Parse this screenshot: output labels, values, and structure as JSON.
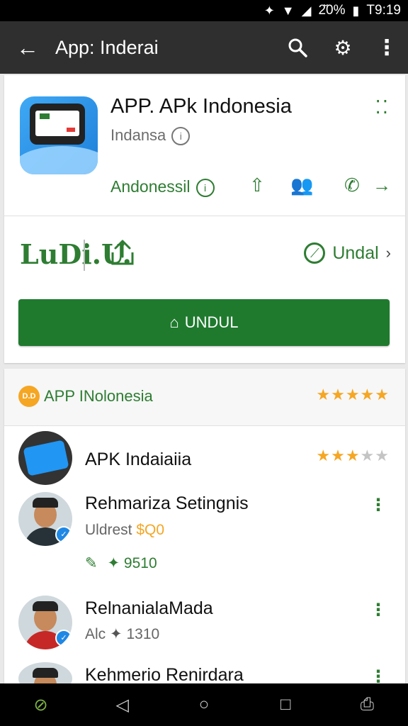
{
  "status_bar": {
    "battery_text": "2̆0%",
    "time": "T9:19"
  },
  "app_bar": {
    "title": "App: Inderai"
  },
  "app": {
    "name": "APP. APk Indonesia",
    "developer": "Indansa",
    "category": "Andonessil"
  },
  "logo_text": "LuDi.U.",
  "install_link": "Undal",
  "install_button": "UNDUL",
  "section": {
    "badge": "D.D",
    "title": "APP INolonesia",
    "rating": 5
  },
  "reviews": [
    {
      "name": "APK Indaiaiia",
      "rating": 3.5
    },
    {
      "name": "Rehmariza Setingnis",
      "sub": "Uldrest",
      "sub_highlight": "$Q0",
      "meta": "9510"
    },
    {
      "name": "RelnanialaMada",
      "sub": "Alc",
      "meta": "1310"
    },
    {
      "name": "Kehmerio Renirdara"
    }
  ],
  "colors": {
    "accent_green": "#2e7d32",
    "button_green": "#1f7a2e",
    "star_gold": "#f5a623",
    "appbar": "#2f2f2f"
  }
}
